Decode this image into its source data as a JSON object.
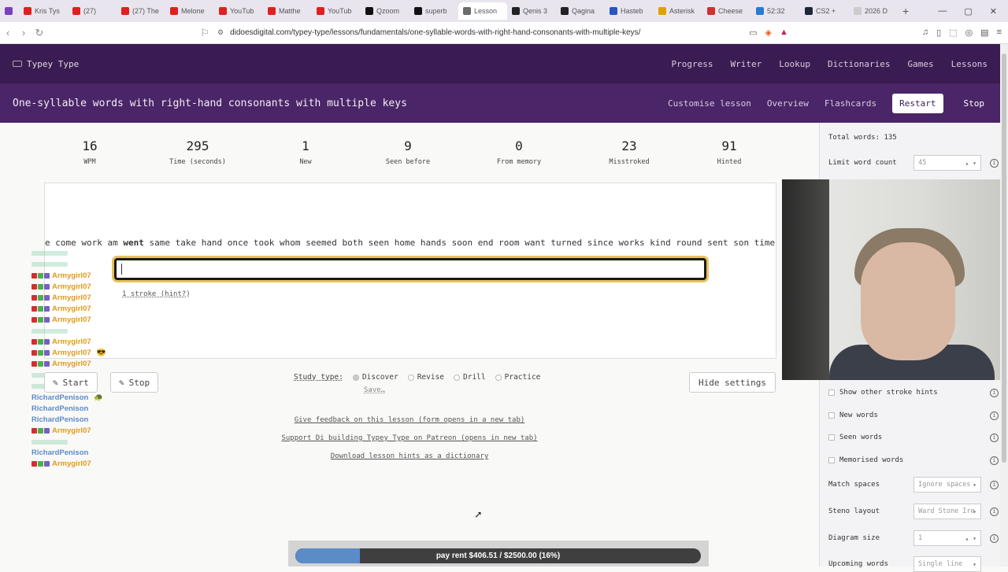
{
  "browser": {
    "tabs": [
      {
        "label": "",
        "color": "#7a3fbf"
      },
      {
        "label": "Kris Tys",
        "color": "#e02020"
      },
      {
        "label": "(27)",
        "color": "#e02020"
      },
      {
        "label": "(27) The",
        "color": "#e02020"
      },
      {
        "label": "Melone",
        "color": "#e02020"
      },
      {
        "label": "YouTub",
        "color": "#e02020"
      },
      {
        "label": "Matthe",
        "color": "#e02020"
      },
      {
        "label": "YouTub",
        "color": "#e02020"
      },
      {
        "label": "Qzoom",
        "color": "#111111"
      },
      {
        "label": "superb",
        "color": "#111111"
      },
      {
        "label": "Lesson",
        "color": "#6a6a6a"
      },
      {
        "label": "Qenis 3",
        "color": "#222222"
      },
      {
        "label": "Qagina",
        "color": "#222222"
      },
      {
        "label": "Hasteb",
        "color": "#2a55c0"
      },
      {
        "label": "Asterisk",
        "color": "#e0a000"
      },
      {
        "label": "Cheese",
        "color": "#d03030"
      },
      {
        "label": "52:32",
        "color": "#2a7ad0"
      },
      {
        "label": "CS2 +",
        "color": "#1b2838"
      },
      {
        "label": "2026 D",
        "color": "#cccccc"
      }
    ],
    "url": "didoesdigital.com/typey-type/lessons/fundamentals/one-syllable-words-with-right-hand-consonants-with-multiple-keys/"
  },
  "site": {
    "logo": "Typey Type",
    "nav": [
      "Progress",
      "Writer",
      "Lookup",
      "Dictionaries",
      "Games",
      "Lessons"
    ]
  },
  "lesson": {
    "title": "One-syllable words with right-hand consonants with multiple keys",
    "customise": "Customise lesson",
    "overview": "Overview",
    "flashcards": "Flashcards",
    "restart": "Restart",
    "stop": "Stop"
  },
  "stats": [
    {
      "value": "16",
      "label": "WPM"
    },
    {
      "value": "295",
      "label": "Time (seconds)"
    },
    {
      "value": "1",
      "label": "New"
    },
    {
      "value": "9",
      "label": "Seen before"
    },
    {
      "value": "0",
      "label": "From memory"
    },
    {
      "value": "23",
      "label": "Misstroked"
    },
    {
      "value": "91",
      "label": "Hinted"
    }
  ],
  "typing": {
    "before": "e come work am ",
    "current": "went",
    "after": " same take hand once took whom seemed both seen home hands soon end room want turned since works kind round sent son times",
    "hint": "1 stroke (hint?)"
  },
  "chat": [
    {
      "name": "",
      "color": "#9a9a9a",
      "msg": "",
      "badges": false
    },
    {
      "name": "",
      "color": "#9a9a9a",
      "msg": "",
      "badges": false
    },
    {
      "name": "Armygirl07",
      "color": "#e09a1a",
      "msg": "",
      "badges": true
    },
    {
      "name": "Armygirl07",
      "color": "#e09a1a",
      "msg": "",
      "badges": true
    },
    {
      "name": "Armygirl07",
      "color": "#e09a1a",
      "msg": "",
      "badges": true
    },
    {
      "name": "Armygirl07",
      "color": "#e09a1a",
      "msg": "",
      "badges": true
    },
    {
      "name": "Armygirl07",
      "color": "#e09a1a",
      "msg": "",
      "badges": true
    },
    {
      "name": "",
      "color": "#9a9a9a",
      "msg": "",
      "badges": false
    },
    {
      "name": "Armygirl07",
      "color": "#e09a1a",
      "msg": "",
      "badges": true
    },
    {
      "name": "Armygirl07",
      "color": "#e09a1a",
      "msg": "😎",
      "badges": true
    },
    {
      "name": "Armygirl07",
      "color": "#e09a1a",
      "msg": "",
      "badges": true
    },
    {
      "name": "",
      "color": "#9a9a9a",
      "msg": "",
      "badges": false
    },
    {
      "name": "",
      "color": "#9a9a9a",
      "msg": "",
      "badges": false
    },
    {
      "name": "RichardPenison",
      "color": "#5b8cc8",
      "msg": "🐢",
      "badges": false
    },
    {
      "name": "RichardPenison",
      "color": "#5b8cc8",
      "msg": "",
      "badges": false
    },
    {
      "name": "RichardPenison",
      "color": "#5b8cc8",
      "msg": "",
      "badges": false
    },
    {
      "name": "Armygirl07",
      "color": "#e09a1a",
      "msg": "",
      "badges": true
    },
    {
      "name": "",
      "color": "#9a9a9a",
      "msg": "",
      "badges": false
    },
    {
      "name": "RichardPenison",
      "color": "#5b8cc8",
      "msg": "",
      "badges": false
    },
    {
      "name": "Armygirl07",
      "color": "#e09a1a",
      "msg": "",
      "badges": true
    }
  ],
  "controls": {
    "start": "Start",
    "stop": "Stop",
    "study_label": "Study type:",
    "study_options": [
      "Discover",
      "Revise",
      "Drill",
      "Practice"
    ],
    "study_selected": "Discover",
    "save": "Save…",
    "hide_settings": "Hide settings"
  },
  "footer": {
    "feedback": "Give feedback on this lesson (form opens in a new tab)",
    "patreon": "Support Di building Typey Type on Patreon (opens in new tab)",
    "download": "Download lesson hints as a dictionary"
  },
  "sidebar": {
    "total_words": "Total words: 135",
    "limit_label": "Limit word count",
    "limit_value": "45",
    "checks": [
      "Show other stroke hints",
      "New words",
      "Seen words",
      "Memorised words"
    ],
    "match_spaces_label": "Match spaces",
    "match_spaces_value": "Ignore spaces",
    "steno_layout_label": "Steno layout",
    "steno_layout_value": "Ward Stone Ire",
    "diagram_size_label": "Diagram size",
    "diagram_size_value": "1",
    "upcoming_label": "Upcoming words",
    "upcoming_value": "Single line"
  },
  "donation": {
    "text": "pay rent $406.51 / $2500.00 (16%)",
    "progress": 0.16,
    "fill_color": "#5b8cc8"
  }
}
